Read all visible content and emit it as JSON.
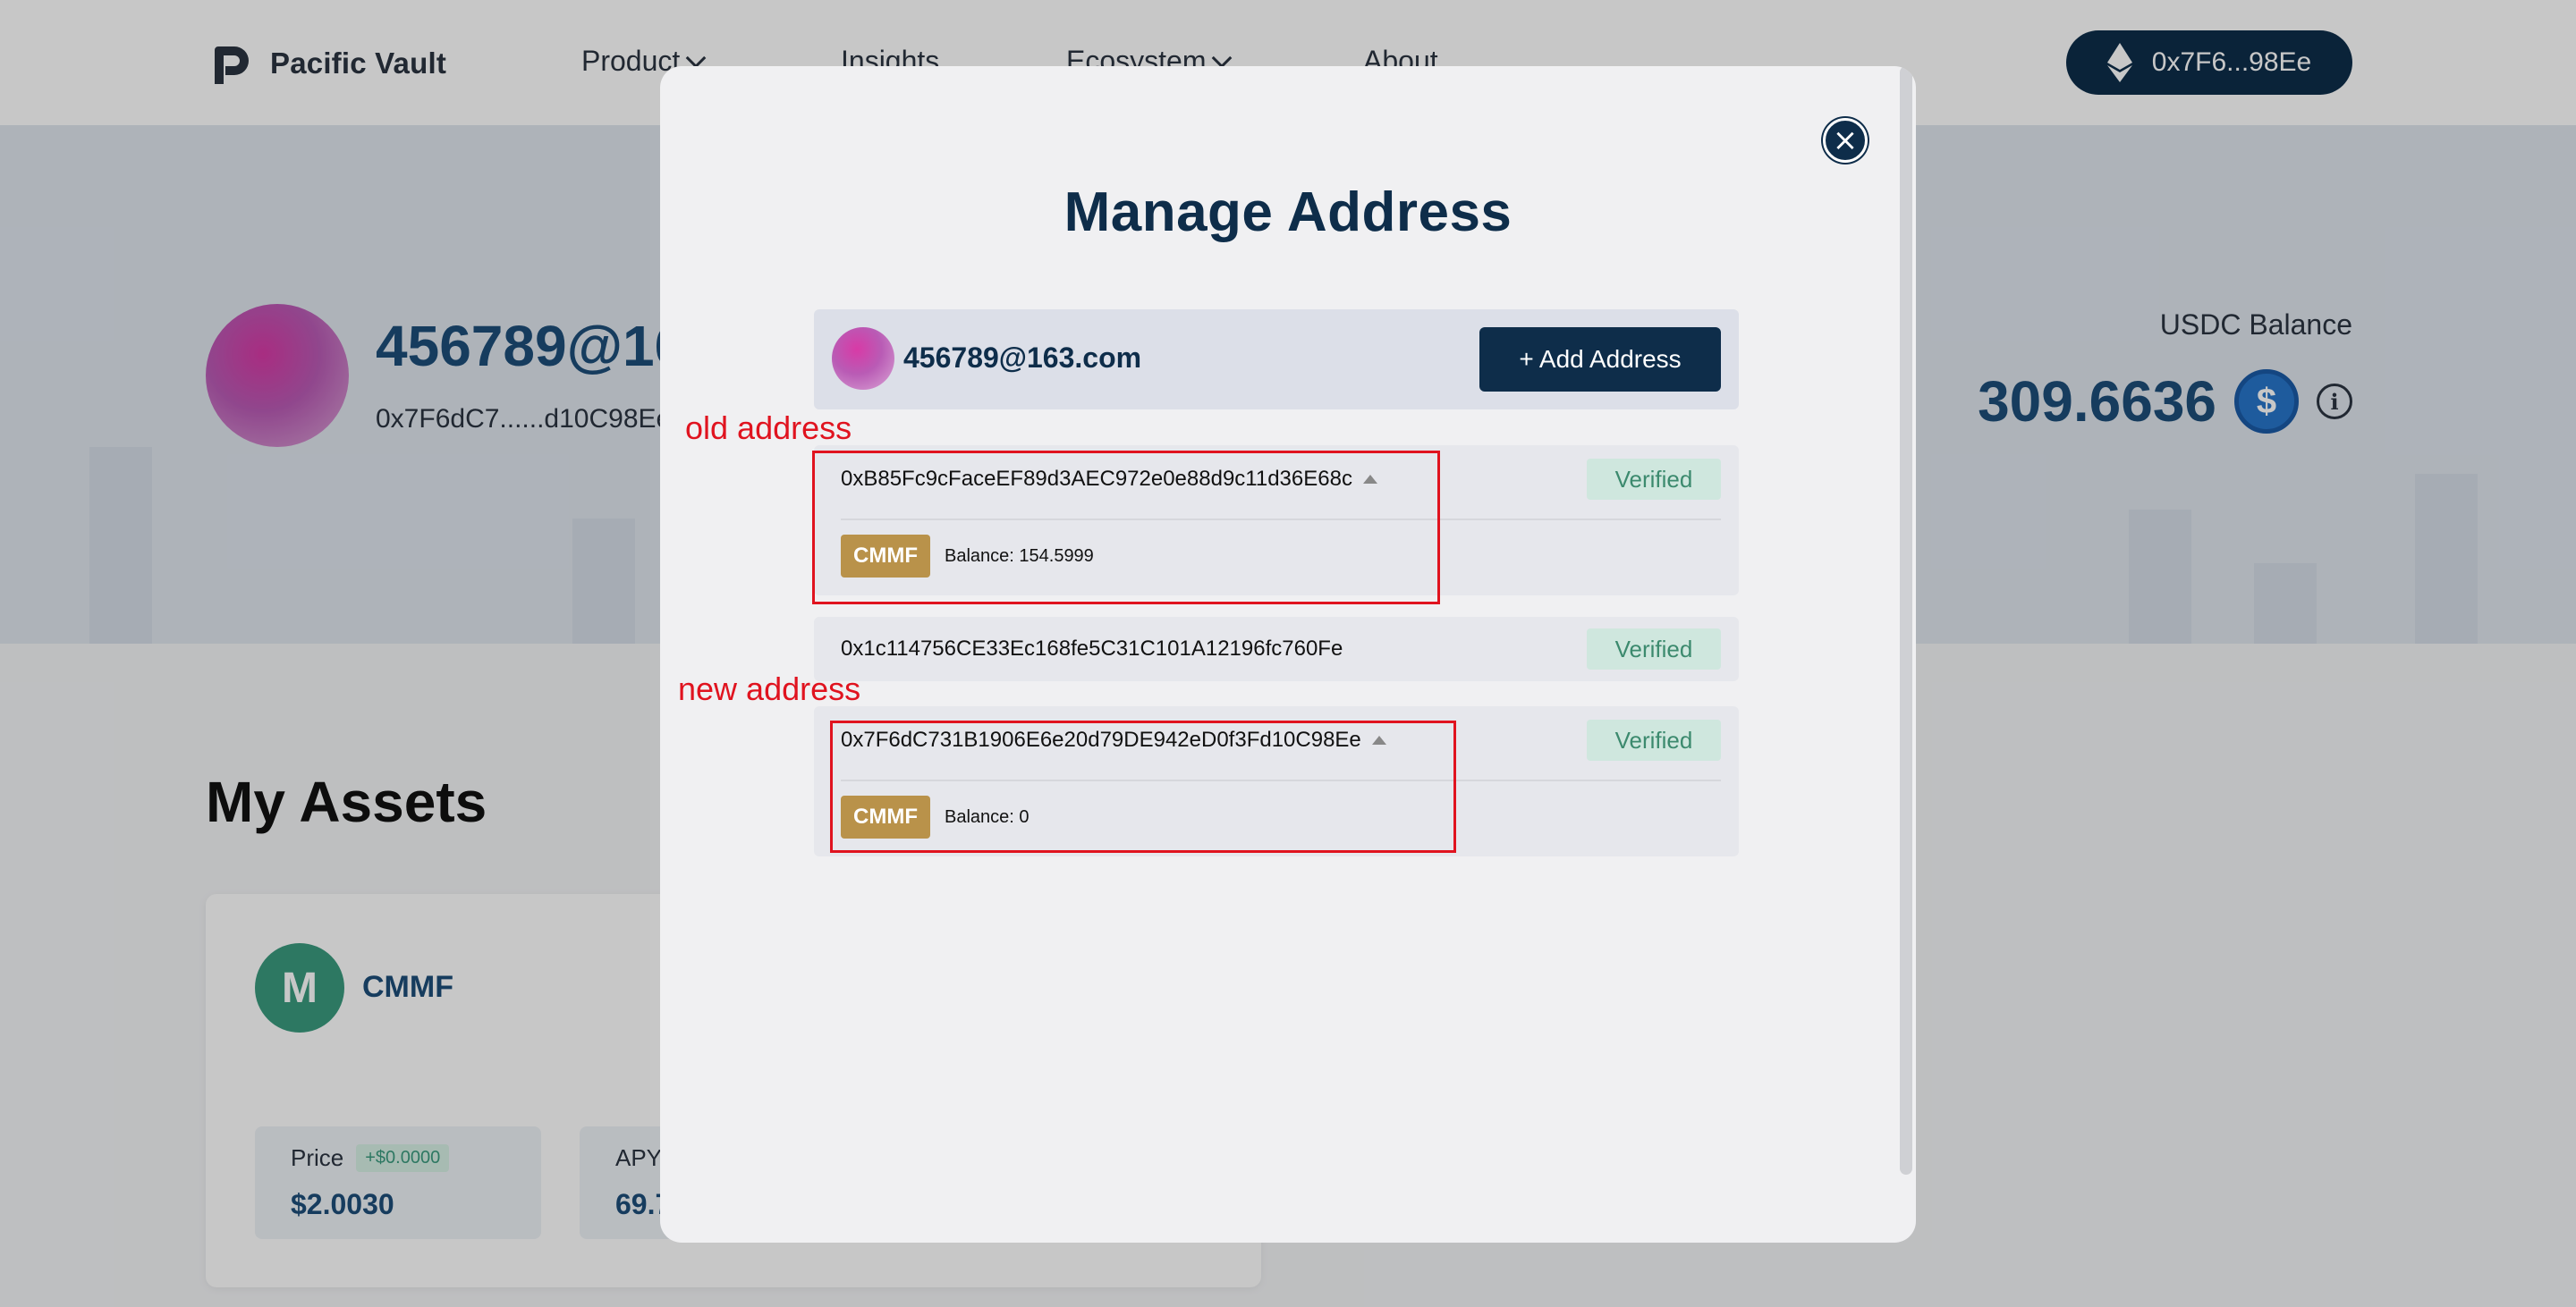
{
  "nav": {
    "brand": "Pacific Vault",
    "items": [
      {
        "label": "Product"
      },
      {
        "label": "Insights"
      },
      {
        "label": "Ecosystem"
      },
      {
        "label": "About"
      }
    ],
    "wallet": "0x7F6...98Ee"
  },
  "profile": {
    "email": "456789@163.com",
    "address_short": "0x7F6dC7......d10C98Ee",
    "usdc_label": "USDC Balance",
    "usdc_value": "309.6636"
  },
  "assets": {
    "title": "My Assets",
    "card": {
      "name": "CMMF",
      "price_label": "Price",
      "price_change": "+$0.0000",
      "price_value": "$2.0030",
      "apy_label": "APY",
      "apy_value": "69.7"
    }
  },
  "modal": {
    "title": "Manage Address",
    "account_email": "456789@163.com",
    "add_button": "+ Add Address",
    "addresses": [
      {
        "address": "0xB85Fc9cFaceEF89d3AEC972e0e88d9c11d36E68c",
        "status": "Verified",
        "expanded": true,
        "token": "CMMF",
        "balance": "Balance: 154.5999"
      },
      {
        "address": "0x1c114756CE33Ec168fe5C31C101A12196fc760Fe",
        "status": "Verified",
        "expanded": false
      },
      {
        "address": "0x7F6dC731B1906E6e20d79DE942eD0f3Fd10C98Ee",
        "status": "Verified",
        "expanded": true,
        "token": "CMMF",
        "balance": "Balance: 0"
      }
    ]
  },
  "annotations": {
    "old_label": "old address",
    "new_label": "new address",
    "color": "#e0131f"
  }
}
